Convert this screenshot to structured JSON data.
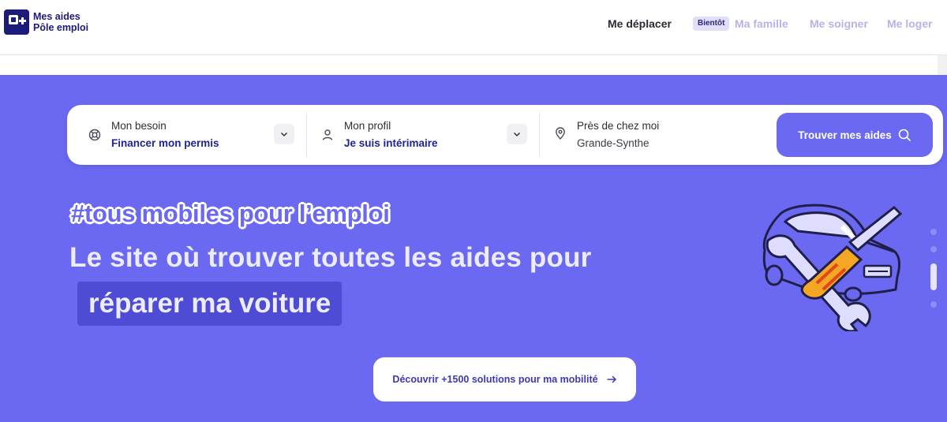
{
  "logo": {
    "line1": "Mes aides",
    "line2": "Pôle emploi"
  },
  "nav": {
    "active": "Me déplacer",
    "badge": "Bientôt",
    "upcoming": [
      "Ma famille",
      "Me soigner",
      "Me loger"
    ]
  },
  "search": {
    "need": {
      "label": "Mon besoin",
      "value": "Financer mon permis"
    },
    "profile": {
      "label": "Mon profil",
      "value": "Je suis intérimaire"
    },
    "location": {
      "label": "Près de chez moi",
      "value": "Grande-Synthe"
    },
    "button": "Trouver mes aides"
  },
  "hero": {
    "hashtag": "#tous mobiles pour l’emploi",
    "headline": "Le site où trouver toutes les aides pour",
    "highlight": "réparer ma voiture",
    "cta": "Découvrir +1500 solutions pour ma mobilité"
  },
  "carousel": {
    "slides": 4,
    "active_index": 2
  },
  "colors": {
    "brand": "#6b69f1",
    "navy": "#1d1b7a",
    "highlight": "#4e4bd4"
  }
}
